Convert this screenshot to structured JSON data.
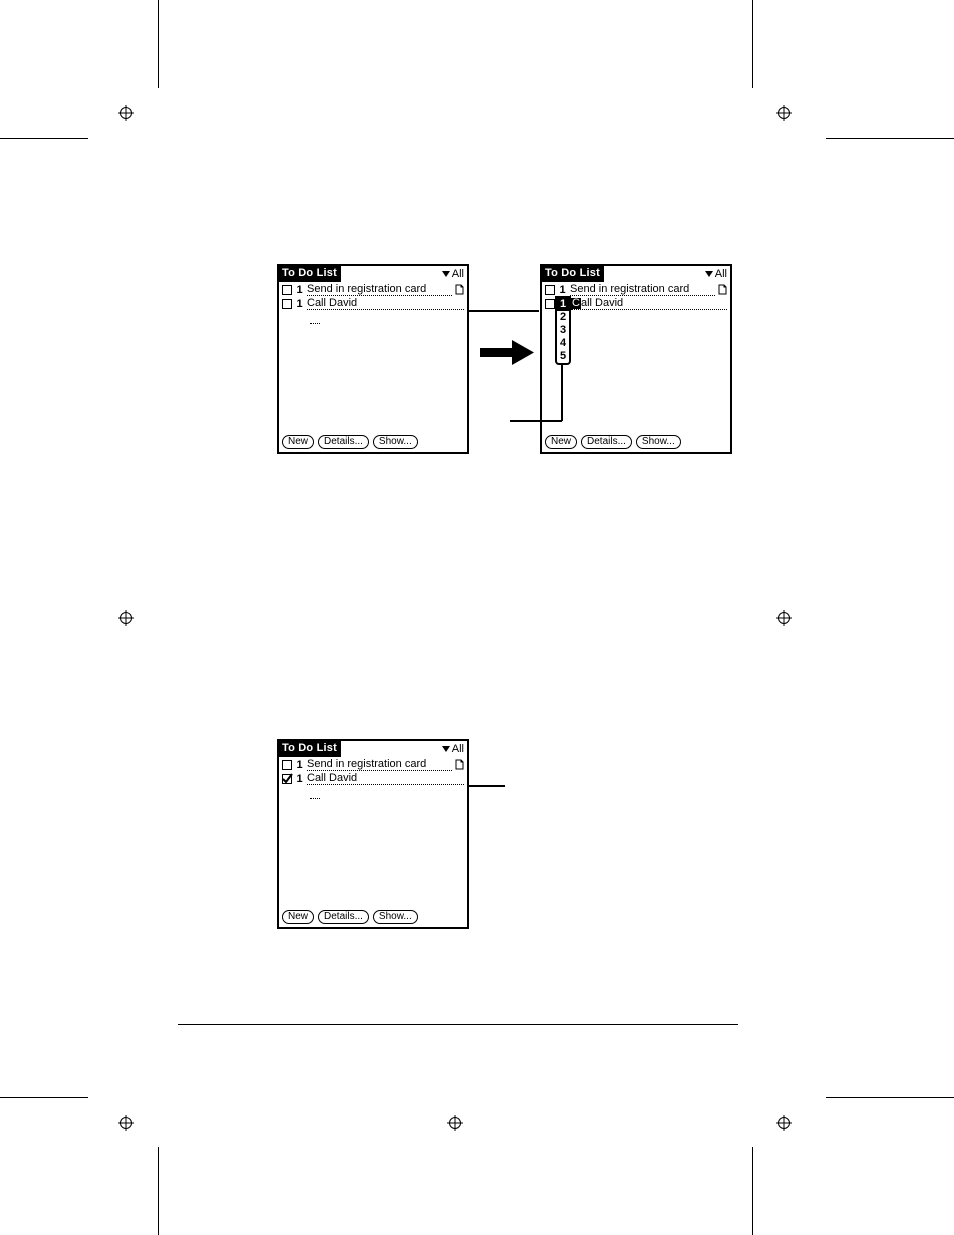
{
  "palm": {
    "title": "To Do List",
    "category": "All",
    "buttons": {
      "new": "New",
      "details": "Details...",
      "show": "Show..."
    }
  },
  "screens": {
    "a": {
      "items": [
        {
          "checked": false,
          "priority": "1",
          "text": "Send in registration card",
          "note": true
        },
        {
          "checked": false,
          "priority": "1",
          "text": "Call David",
          "note": false,
          "editing": true
        }
      ]
    },
    "b": {
      "items": [
        {
          "checked": false,
          "priority": "1",
          "text": "Send in registration card",
          "note": true
        },
        {
          "checked": false,
          "priority": "1",
          "text": "all David",
          "note": false,
          "priority_selected": true
        }
      ],
      "popup": {
        "options": [
          "1",
          "2",
          "3",
          "4",
          "5"
        ],
        "selected": "1"
      }
    },
    "c": {
      "items": [
        {
          "checked": false,
          "priority": "1",
          "text": "Send in registration card",
          "note": true
        },
        {
          "checked": true,
          "priority": "1",
          "text": "Call David",
          "note": false
        }
      ]
    }
  }
}
